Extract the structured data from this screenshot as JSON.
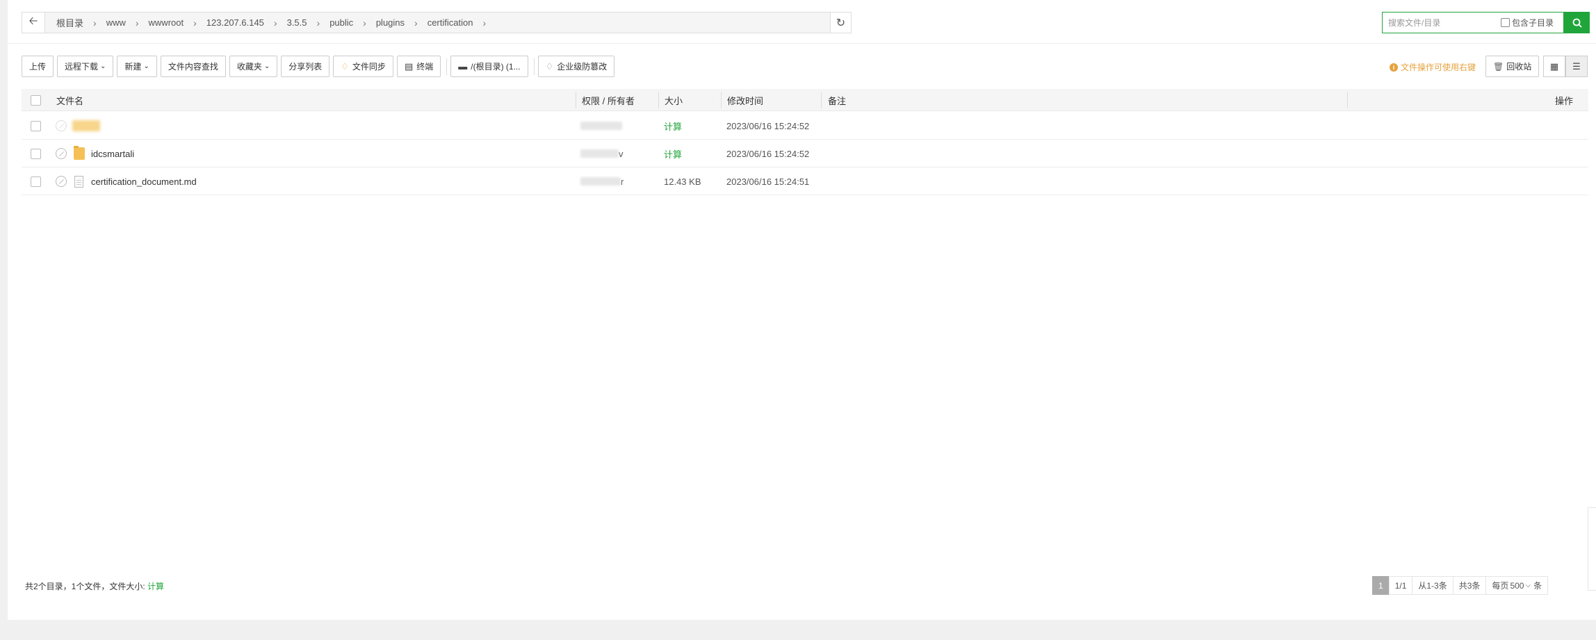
{
  "breadcrumbs": [
    "根目录",
    "www",
    "wwwroot",
    "123.207.6.145",
    "3.5.5",
    "public",
    "plugins",
    "certification"
  ],
  "search": {
    "placeholder": "搜索文件/目录",
    "include_sub_label": "包含子目录"
  },
  "toolbar": {
    "upload": "上传",
    "remote_download": "远程下载",
    "new": "新建",
    "content_search": "文件内容查找",
    "favorites": "收藏夹",
    "share_list": "分享列表",
    "file_sync": "文件同步",
    "terminal": "终端",
    "disk": "/(根目录) (1...",
    "tamper_protect": "企业级防篡改"
  },
  "tip": "文件操作可使用右键",
  "recycle_bin": "回收站",
  "table": {
    "headers": {
      "name": "文件名",
      "perm": "权限 / 所有者",
      "size": "大小",
      "mtime": "修改时间",
      "note": "备注",
      "ops": "操作"
    },
    "rows": [
      {
        "name": "",
        "perm_tail": "",
        "size": "计算",
        "mtime": "2023/06/16 15:24:52",
        "type": "folder"
      },
      {
        "name": "idcsmartali",
        "perm_tail": "v",
        "size": "计算",
        "mtime": "2023/06/16 15:24:52",
        "type": "folder"
      },
      {
        "name": "certification_document.md",
        "perm_tail": "r",
        "size": "12.43 KB",
        "mtime": "2023/06/16 15:24:51",
        "type": "file"
      }
    ]
  },
  "footer": {
    "summary": "共2个目录，1个文件，文件大小:",
    "calc": "计算",
    "pager": {
      "current": "1",
      "pages": "1/1",
      "range": "从1-3条",
      "total": "共3条",
      "per_page_label": "每页",
      "per_page": "500",
      "unit": "条"
    }
  },
  "colors": {
    "accent": "#20a53a",
    "warning": "#e6a23c"
  }
}
